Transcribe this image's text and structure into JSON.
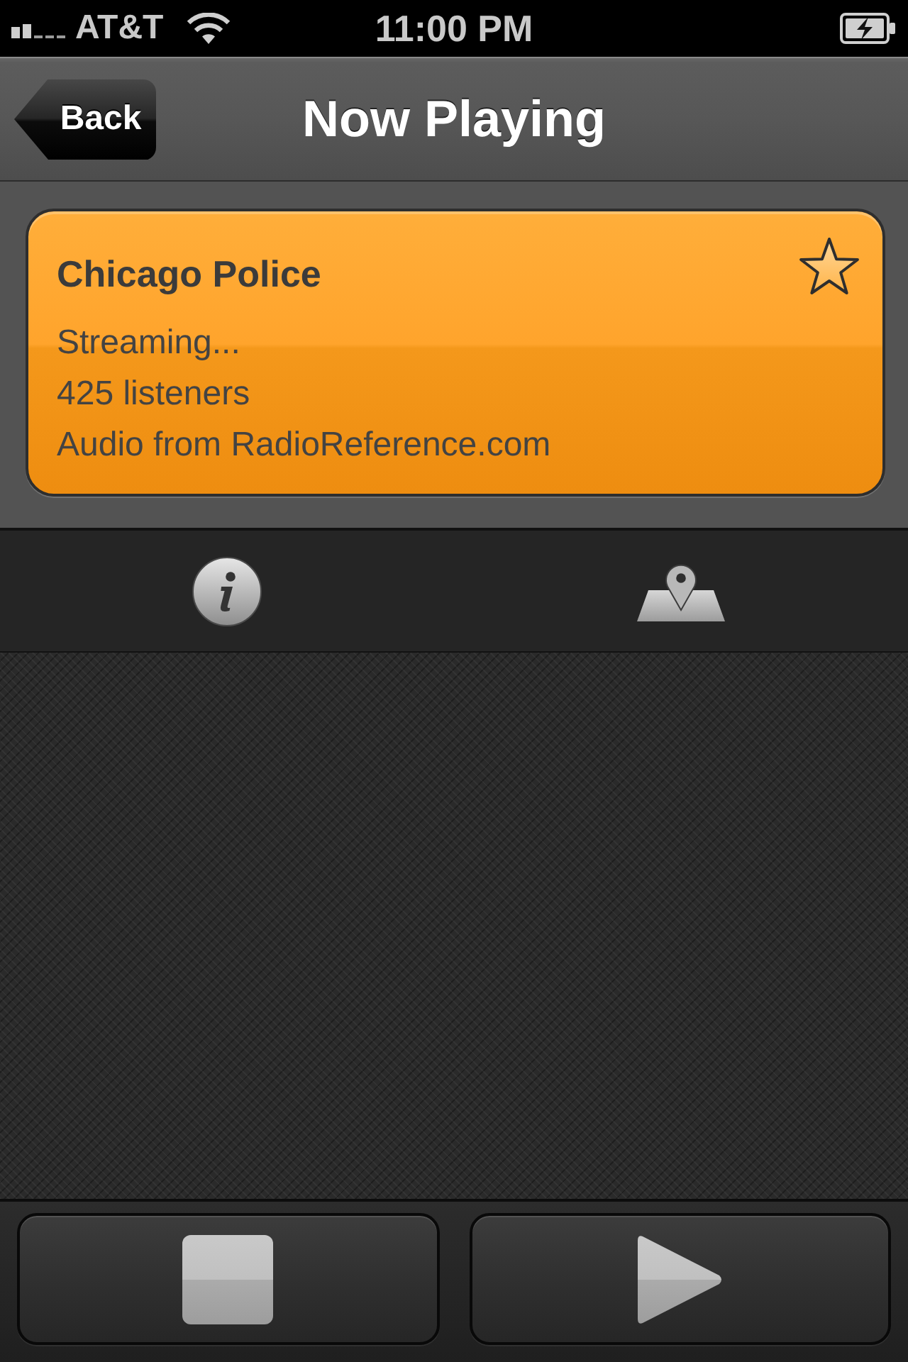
{
  "status_bar": {
    "carrier": "AT&T",
    "time": "11:00 PM"
  },
  "nav_bar": {
    "back_button": "Back",
    "title": "Now Playing"
  },
  "station": {
    "name": "Chicago Police",
    "favorite": false,
    "lines": [
      "Streaming...",
      "425 listeners",
      "Audio from RadioReference.com"
    ]
  },
  "toolbar": [
    {
      "kind": "info"
    },
    {
      "kind": "map"
    }
  ],
  "controls": [
    {
      "kind": "stop"
    },
    {
      "kind": "play"
    }
  ]
}
